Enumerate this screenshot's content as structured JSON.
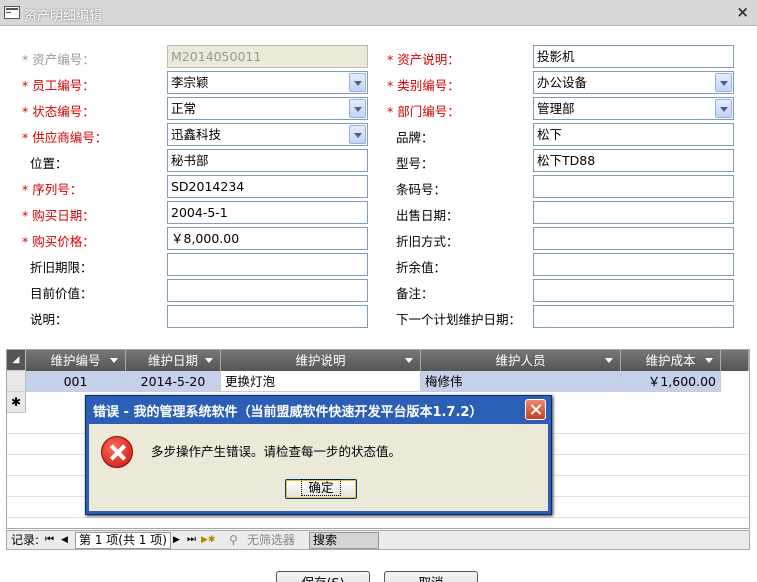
{
  "window": {
    "title": "资产明细编辑",
    "close_glyph": "×"
  },
  "left_fields": [
    {
      "label": "* 资产编号：",
      "value": "M2014050011",
      "required": true,
      "readonly": true,
      "dropdown": false
    },
    {
      "label": "* 员工编号：",
      "value": "李宗颖",
      "required": true,
      "readonly": false,
      "dropdown": true
    },
    {
      "label": "* 状态编号：",
      "value": "正常",
      "required": true,
      "readonly": false,
      "dropdown": true
    },
    {
      "label": "* 供应商编号：",
      "value": "迅鑫科技",
      "required": true,
      "readonly": false,
      "dropdown": true
    },
    {
      "label": "位置：",
      "value": "秘书部",
      "required": false,
      "readonly": false,
      "dropdown": false
    },
    {
      "label": "* 序列号：",
      "value": "SD2014234",
      "required": true,
      "readonly": false,
      "dropdown": false
    },
    {
      "label": "* 购买日期：",
      "value": "2004-5-1",
      "required": true,
      "readonly": false,
      "dropdown": false
    },
    {
      "label": "* 购买价格：",
      "value": "￥8,000.00",
      "required": true,
      "readonly": false,
      "dropdown": false
    },
    {
      "label": "折旧期限：",
      "value": "",
      "required": false,
      "readonly": false,
      "dropdown": false
    },
    {
      "label": "目前价值：",
      "value": "",
      "required": false,
      "readonly": false,
      "dropdown": false
    },
    {
      "label": "说明：",
      "value": "",
      "required": false,
      "readonly": false,
      "dropdown": false
    }
  ],
  "right_fields": [
    {
      "label": "* 资产说明：",
      "value": "投影机",
      "required": true,
      "dropdown": false
    },
    {
      "label": "* 类别编号：",
      "value": "办公设备",
      "required": true,
      "dropdown": true
    },
    {
      "label": "* 部门编号：",
      "value": "管理部",
      "required": true,
      "dropdown": true
    },
    {
      "label": "品牌：",
      "value": "松下",
      "required": false,
      "dropdown": false
    },
    {
      "label": "型号：",
      "value": "松下TD88",
      "required": false,
      "dropdown": false
    },
    {
      "label": "条码号：",
      "value": "",
      "required": false,
      "dropdown": false
    },
    {
      "label": "出售日期：",
      "value": "",
      "required": false,
      "dropdown": false
    },
    {
      "label": "折旧方式：",
      "value": "",
      "required": false,
      "dropdown": false
    },
    {
      "label": "折余值：",
      "value": "",
      "required": false,
      "dropdown": false
    },
    {
      "label": "备注：",
      "value": "",
      "required": false,
      "dropdown": false
    },
    {
      "label": "下一个计划维护日期：",
      "value": "",
      "required": false,
      "dropdown": false
    }
  ],
  "grid": {
    "corner_glyph": "◢",
    "new_row_glyph": "✱",
    "columns": [
      "维护编号",
      "维护日期",
      "维护说明",
      "维护人员",
      "维护成本"
    ],
    "rows": [
      [
        "001",
        "2014-5-20",
        "更换灯泡",
        "梅修伟",
        "￥1,600.00"
      ]
    ]
  },
  "nav": {
    "label": "记录:",
    "first": "⏮",
    "prev": "◀",
    "position": "第 1 项(共 1 项)",
    "next": "▶",
    "last": "⏭",
    "new": "▶✱",
    "filter": "无筛选器",
    "search": "搜索"
  },
  "buttons": {
    "save": "保存(S)",
    "cancel": "取消"
  },
  "dialog": {
    "title": "错误 - 我的管理系统软件（当前盟威软件快速开发平台版本1.7.2）",
    "message": "多步操作产生错误。请检查每一步的状态值。",
    "ok": "确定"
  }
}
